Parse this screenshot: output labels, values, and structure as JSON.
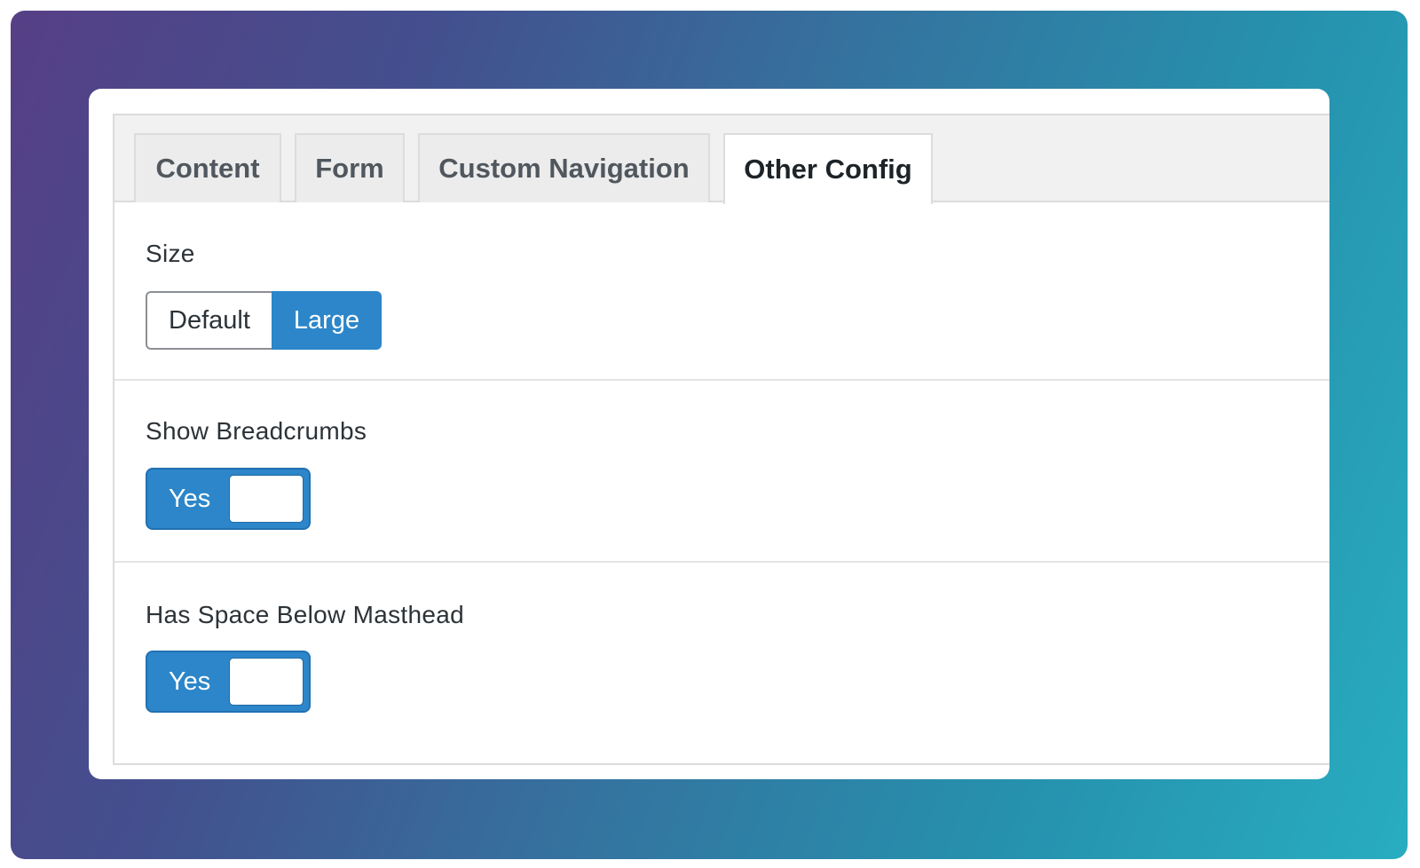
{
  "tabs": [
    {
      "label": "Content",
      "active": false
    },
    {
      "label": "Form",
      "active": false
    },
    {
      "label": "Custom Navigation",
      "active": false
    },
    {
      "label": "Other Config",
      "active": true
    }
  ],
  "fields": {
    "size": {
      "label": "Size",
      "options": [
        "Default",
        "Large"
      ],
      "selected": "Large"
    },
    "show_breadcrumbs": {
      "label": "Show Breadcrumbs",
      "toggle_label": "Yes",
      "checked": true
    },
    "has_space_below_masthead": {
      "label": "Has Space Below Masthead",
      "toggle_label": "Yes",
      "checked": true
    }
  },
  "colors": {
    "accent": "#2c86c9",
    "background_gradient_start": "#563f86",
    "background_gradient_end": "#28adc0"
  }
}
